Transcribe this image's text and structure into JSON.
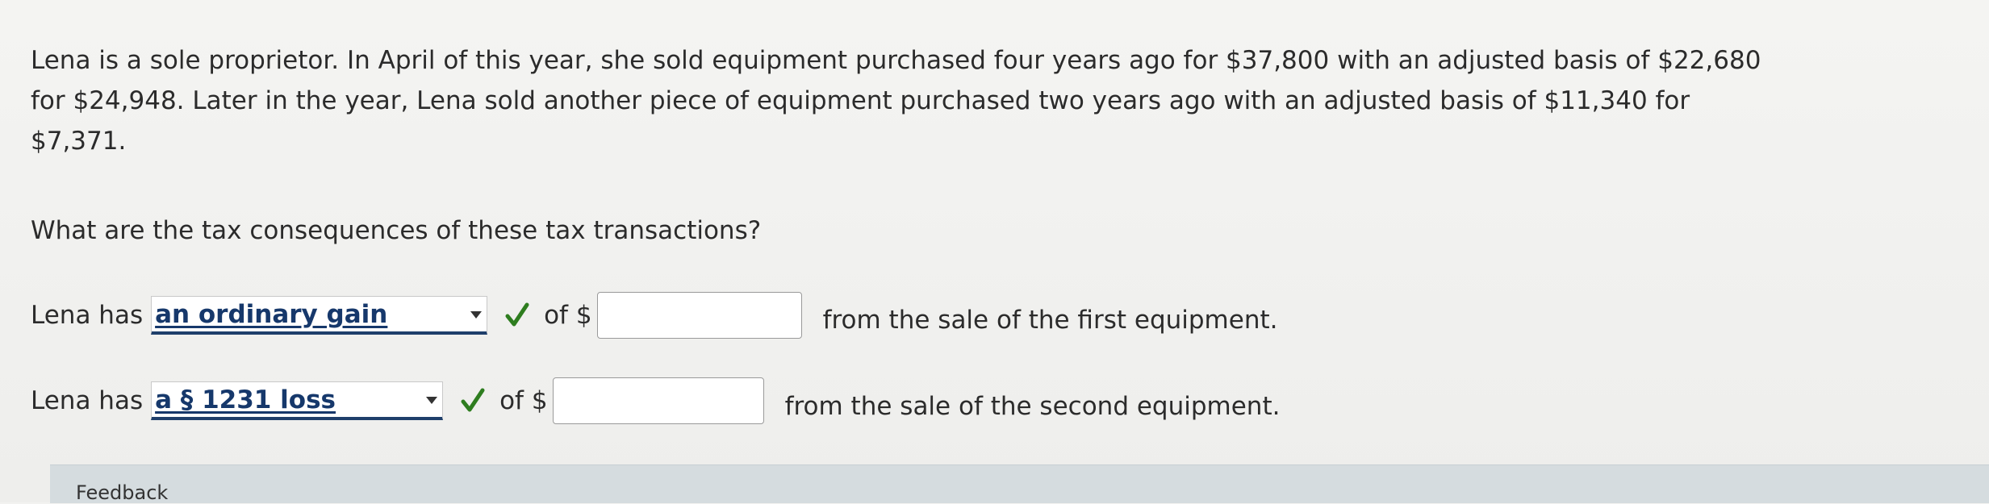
{
  "question": {
    "line1": "Lena is a sole proprietor. In April of this year, she sold equipment purchased four years ago for $37,800 with an adjusted basis of $22,680",
    "line2": "for $24,948. Later in the year, Lena sold another piece of equipment purchased two years ago with an adjusted basis of $11,340 for",
    "line3": "$7,371."
  },
  "prompt": "What are the tax consequences of these tax transactions?",
  "rows": [
    {
      "lead": "Lena has",
      "selected": "an ordinary gain",
      "of_label": "of $",
      "input_value": "",
      "tail": "from the sale of the first equipment."
    },
    {
      "lead": "Lena has",
      "selected": "a § 1231 loss",
      "of_label": "of $",
      "input_value": "",
      "tail": "from the sale of the second equipment."
    }
  ],
  "icons": {
    "correct": "check-icon",
    "dropdown": "caret-down-icon"
  },
  "colors": {
    "selected_text": "#16386b",
    "check": "#2e7d1f",
    "feedback_bar": "#d5dcdf"
  },
  "feedback": {
    "label": "Feedback"
  }
}
